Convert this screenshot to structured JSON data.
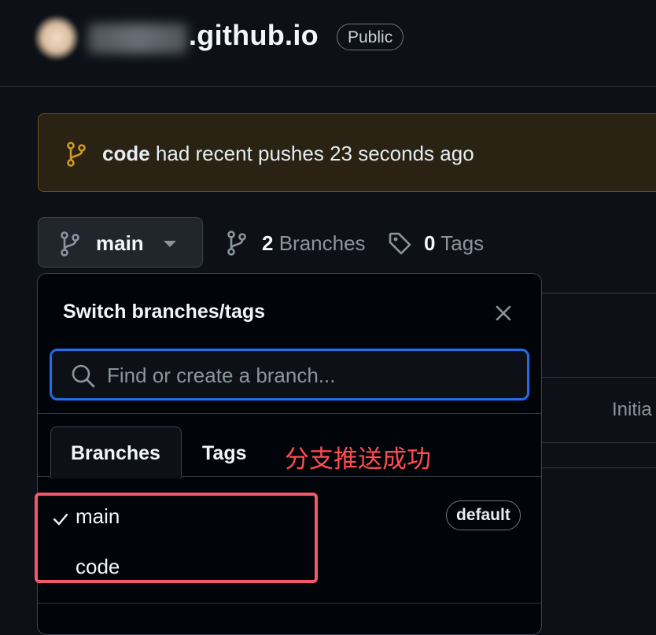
{
  "header": {
    "repo_suffix": ".github.io",
    "visibility": "Public"
  },
  "banner": {
    "branch": "code",
    "message": "had recent pushes 23 seconds ago"
  },
  "branch_bar": {
    "current_branch": "main",
    "branches_count": "2",
    "branches_label": "Branches",
    "tags_count": "0",
    "tags_label": "Tags"
  },
  "background": {
    "fragment_text": "Initia"
  },
  "popover": {
    "title": "Switch branches/tags",
    "search_placeholder": "Find or create a branch...",
    "tabs": {
      "branches": "Branches",
      "tags": "Tags"
    },
    "annotation": "分支推送成功",
    "items": [
      {
        "name": "main",
        "badge": "default",
        "selected": true
      },
      {
        "name": "code"
      }
    ]
  },
  "icons": {
    "banner": "git-branch-icon",
    "branch_button": "git-branch-icon",
    "branches_count": "git-branch-icon",
    "tags": "tag-icon",
    "close": "close-icon",
    "search": "search-icon",
    "selected": "check-icon"
  },
  "colors": {
    "accent_blue": "#1f6feb",
    "warning_border": "#6b5412",
    "banner_icon": "#d29922",
    "annotation_red": "#ff4d4f",
    "highlight_red": "#f4566b"
  }
}
